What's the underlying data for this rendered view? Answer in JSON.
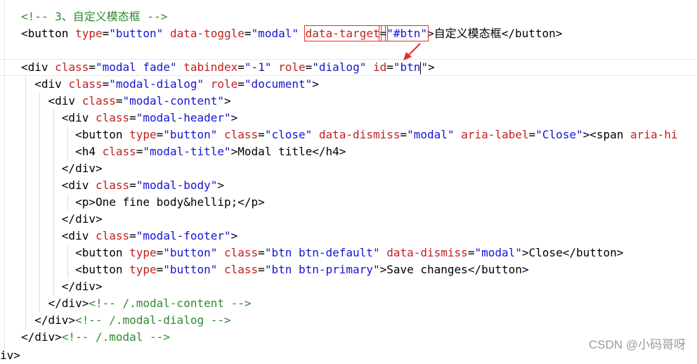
{
  "watermark": "CSDN @小码哥呀",
  "lines": [
    [
      {
        "c": "cm",
        "t": "<!-- 3、自定义模态框 -->"
      }
    ],
    [
      {
        "c": "tg",
        "t": "<button "
      },
      {
        "c": "at",
        "t": "type"
      },
      {
        "c": "tg",
        "t": "="
      },
      {
        "c": "vl",
        "t": "\"button\""
      },
      {
        "c": "tg",
        "t": " "
      },
      {
        "c": "at",
        "t": "data-toggle"
      },
      {
        "c": "tg",
        "t": "="
      },
      {
        "c": "vl",
        "t": "\"modal\""
      },
      {
        "c": "tg",
        "t": " "
      },
      {
        "c": "at",
        "t": "data-target",
        "box": true
      },
      {
        "c": "tg",
        "t": "=",
        "box": true
      },
      {
        "c": "vl",
        "t": "\"#btn\"",
        "box": true
      },
      {
        "c": "tg",
        "t": ">"
      },
      {
        "c": "tx",
        "t": "自定义模态框"
      },
      {
        "c": "tg",
        "t": "</button>"
      }
    ],
    [],
    [
      {
        "c": "tg",
        "t": "<div "
      },
      {
        "c": "at",
        "t": "class"
      },
      {
        "c": "tg",
        "t": "="
      },
      {
        "c": "vl",
        "t": "\"modal fade\""
      },
      {
        "c": "tg",
        "t": " "
      },
      {
        "c": "at",
        "t": "tabindex"
      },
      {
        "c": "tg",
        "t": "="
      },
      {
        "c": "vl",
        "t": "\"-1\""
      },
      {
        "c": "tg",
        "t": " "
      },
      {
        "c": "at",
        "t": "role"
      },
      {
        "c": "tg",
        "t": "="
      },
      {
        "c": "vl",
        "t": "\"dialog\""
      },
      {
        "c": "tg",
        "t": " "
      },
      {
        "c": "at",
        "t": "id"
      },
      {
        "c": "tg",
        "t": "="
      },
      {
        "c": "vl",
        "t": "\"btn",
        "cursor": true
      },
      {
        "c": "vl",
        "t": "\""
      },
      {
        "c": "tg",
        "t": ">"
      }
    ],
    [
      {
        "c": "tg",
        "t": "  <div "
      },
      {
        "c": "at",
        "t": "class"
      },
      {
        "c": "tg",
        "t": "="
      },
      {
        "c": "vl",
        "t": "\"modal-dialog\""
      },
      {
        "c": "tg",
        "t": " "
      },
      {
        "c": "at",
        "t": "role"
      },
      {
        "c": "tg",
        "t": "="
      },
      {
        "c": "vl",
        "t": "\"document\""
      },
      {
        "c": "tg",
        "t": ">"
      }
    ],
    [
      {
        "c": "tg",
        "t": "    <div "
      },
      {
        "c": "at",
        "t": "class"
      },
      {
        "c": "tg",
        "t": "="
      },
      {
        "c": "vl",
        "t": "\"modal-content\""
      },
      {
        "c": "tg",
        "t": ">"
      }
    ],
    [
      {
        "c": "tg",
        "t": "      <div "
      },
      {
        "c": "at",
        "t": "class"
      },
      {
        "c": "tg",
        "t": "="
      },
      {
        "c": "vl",
        "t": "\"modal-header\""
      },
      {
        "c": "tg",
        "t": ">"
      }
    ],
    [
      {
        "c": "tg",
        "t": "        <button "
      },
      {
        "c": "at",
        "t": "type"
      },
      {
        "c": "tg",
        "t": "="
      },
      {
        "c": "vl",
        "t": "\"button\""
      },
      {
        "c": "tg",
        "t": " "
      },
      {
        "c": "at",
        "t": "class"
      },
      {
        "c": "tg",
        "t": "="
      },
      {
        "c": "vl",
        "t": "\"close\""
      },
      {
        "c": "tg",
        "t": " "
      },
      {
        "c": "at",
        "t": "data-dismiss"
      },
      {
        "c": "tg",
        "t": "="
      },
      {
        "c": "vl",
        "t": "\"modal\""
      },
      {
        "c": "tg",
        "t": " "
      },
      {
        "c": "at",
        "t": "aria-label"
      },
      {
        "c": "tg",
        "t": "="
      },
      {
        "c": "vl",
        "t": "\"Close\""
      },
      {
        "c": "tg",
        "t": "><span "
      },
      {
        "c": "at",
        "t": "aria-hi"
      }
    ],
    [
      {
        "c": "tg",
        "t": "        <h4 "
      },
      {
        "c": "at",
        "t": "class"
      },
      {
        "c": "tg",
        "t": "="
      },
      {
        "c": "vl",
        "t": "\"modal-title\""
      },
      {
        "c": "tg",
        "t": ">"
      },
      {
        "c": "tx",
        "t": "Modal title"
      },
      {
        "c": "tg",
        "t": "</h4>"
      }
    ],
    [
      {
        "c": "tg",
        "t": "      </div>"
      }
    ],
    [
      {
        "c": "tg",
        "t": "      <div "
      },
      {
        "c": "at",
        "t": "class"
      },
      {
        "c": "tg",
        "t": "="
      },
      {
        "c": "vl",
        "t": "\"modal-body\""
      },
      {
        "c": "tg",
        "t": ">"
      }
    ],
    [
      {
        "c": "tg",
        "t": "        <p>"
      },
      {
        "c": "tx",
        "t": "One fine body&hellip;"
      },
      {
        "c": "tg",
        "t": "</p>"
      }
    ],
    [
      {
        "c": "tg",
        "t": "      </div>"
      }
    ],
    [
      {
        "c": "tg",
        "t": "      <div "
      },
      {
        "c": "at",
        "t": "class"
      },
      {
        "c": "tg",
        "t": "="
      },
      {
        "c": "vl",
        "t": "\"modal-footer\""
      },
      {
        "c": "tg",
        "t": ">"
      }
    ],
    [
      {
        "c": "tg",
        "t": "        <button "
      },
      {
        "c": "at",
        "t": "type"
      },
      {
        "c": "tg",
        "t": "="
      },
      {
        "c": "vl",
        "t": "\"button\""
      },
      {
        "c": "tg",
        "t": " "
      },
      {
        "c": "at",
        "t": "class"
      },
      {
        "c": "tg",
        "t": "="
      },
      {
        "c": "vl",
        "t": "\"btn btn-default\""
      },
      {
        "c": "tg",
        "t": " "
      },
      {
        "c": "at",
        "t": "data-dismiss"
      },
      {
        "c": "tg",
        "t": "="
      },
      {
        "c": "vl",
        "t": "\"modal\""
      },
      {
        "c": "tg",
        "t": ">"
      },
      {
        "c": "tx",
        "t": "Close"
      },
      {
        "c": "tg",
        "t": "</button>"
      }
    ],
    [
      {
        "c": "tg",
        "t": "        <button "
      },
      {
        "c": "at",
        "t": "type"
      },
      {
        "c": "tg",
        "t": "="
      },
      {
        "c": "vl",
        "t": "\"button\""
      },
      {
        "c": "tg",
        "t": " "
      },
      {
        "c": "at",
        "t": "class"
      },
      {
        "c": "tg",
        "t": "="
      },
      {
        "c": "vl",
        "t": "\"btn btn-primary\""
      },
      {
        "c": "tg",
        "t": ">"
      },
      {
        "c": "tx",
        "t": "Save changes"
      },
      {
        "c": "tg",
        "t": "</button>"
      }
    ],
    [
      {
        "c": "tg",
        "t": "      </div>"
      }
    ],
    [
      {
        "c": "tg",
        "t": "    </div>"
      },
      {
        "c": "cm",
        "t": "<!-- /.modal-content -->"
      }
    ],
    [
      {
        "c": "tg",
        "t": "  </div>"
      },
      {
        "c": "cm",
        "t": "<!-- /.modal-dialog -->"
      }
    ],
    [
      {
        "c": "tg",
        "t": "</div>"
      },
      {
        "c": "cm",
        "t": "<!-- /.modal -->"
      }
    ],
    [
      {
        "c": "tg",
        "t": "iv>"
      }
    ]
  ]
}
